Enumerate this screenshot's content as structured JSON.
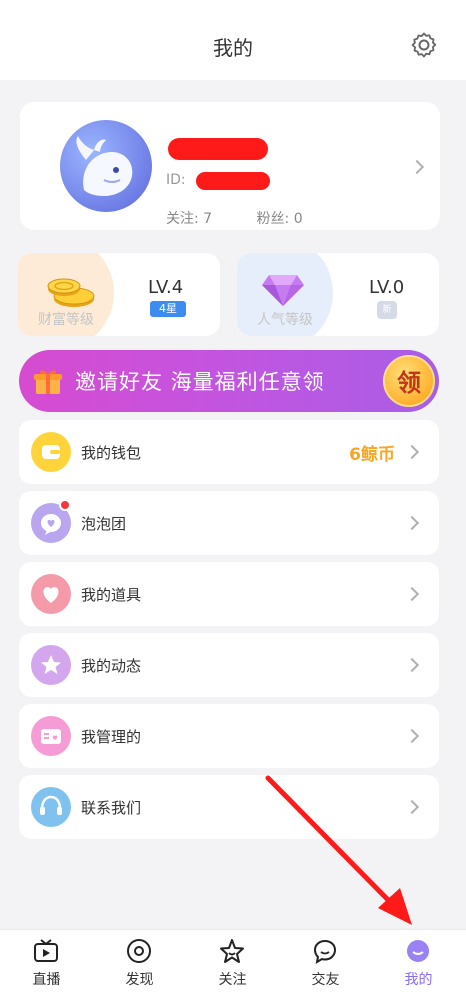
{
  "header": {
    "title": "我的",
    "settings_icon": "gear-icon"
  },
  "profile": {
    "id_label": "ID:",
    "follow_label": "关注: 7",
    "fans_label": "粉丝: 0"
  },
  "levels": {
    "wealth": {
      "label": "财富等级",
      "level": "LV.4",
      "badge": "4星"
    },
    "popularity": {
      "label": "人气等级",
      "level": "LV.0",
      "badge": "新"
    }
  },
  "banner": {
    "text": "邀请好友 海量福利任意领",
    "button": "领"
  },
  "menu": [
    {
      "label": "我的钱包",
      "value": "6鲸币",
      "icon": "wallet-icon",
      "color": "#ffd43b"
    },
    {
      "label": "泡泡团",
      "value": "",
      "icon": "bubble-group-icon",
      "color": "#b9a6ee"
    },
    {
      "label": "我的道具",
      "value": "",
      "icon": "heart-props-icon",
      "color": "#f59aa8"
    },
    {
      "label": "我的动态",
      "value": "",
      "icon": "star-moments-icon",
      "color": "#d3a6ee"
    },
    {
      "label": "我管理的",
      "value": "",
      "icon": "managed-radio-icon",
      "color": "#f59bd5"
    },
    {
      "label": "联系我们",
      "value": "",
      "icon": "headset-icon",
      "color": "#7fc2f0"
    }
  ],
  "tabs": [
    {
      "label": "直播",
      "icon": "live-tv-icon"
    },
    {
      "label": "发现",
      "icon": "eye-discover-icon"
    },
    {
      "label": "关注",
      "icon": "star-follow-icon"
    },
    {
      "label": "交友",
      "icon": "chat-friends-icon"
    },
    {
      "label": "我的",
      "icon": "me-avatar-icon"
    }
  ],
  "colors": {
    "accent": "#8a6cf0",
    "wallet_value": "#f5a623",
    "banner_start": "#d64bd0",
    "banner_end": "#a85ee6",
    "annotation_arrow": "#ff1a1a"
  }
}
